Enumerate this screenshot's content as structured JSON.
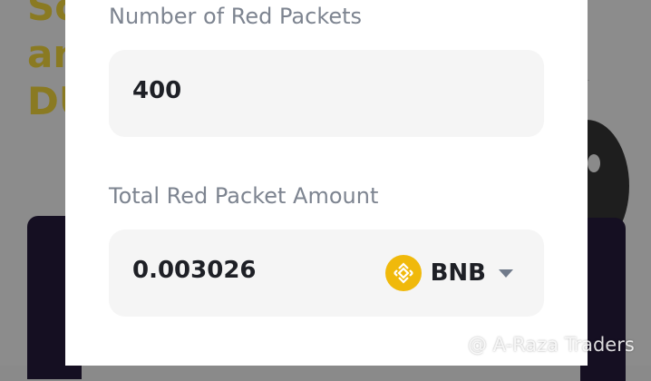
{
  "background": {
    "headline_fragments": [
      "Sc",
      "an",
      "DU"
    ]
  },
  "form": {
    "packets_label": "Number of Red Packets",
    "packets_value": "400",
    "amount_label": "Total Red Packet Amount",
    "amount_value": "0.003026",
    "currency": "BNB",
    "currency_icon": "bnb-coin-icon",
    "currency_color": "#F0B90B"
  },
  "watermark": {
    "text": "@ A-Raza Traders"
  }
}
